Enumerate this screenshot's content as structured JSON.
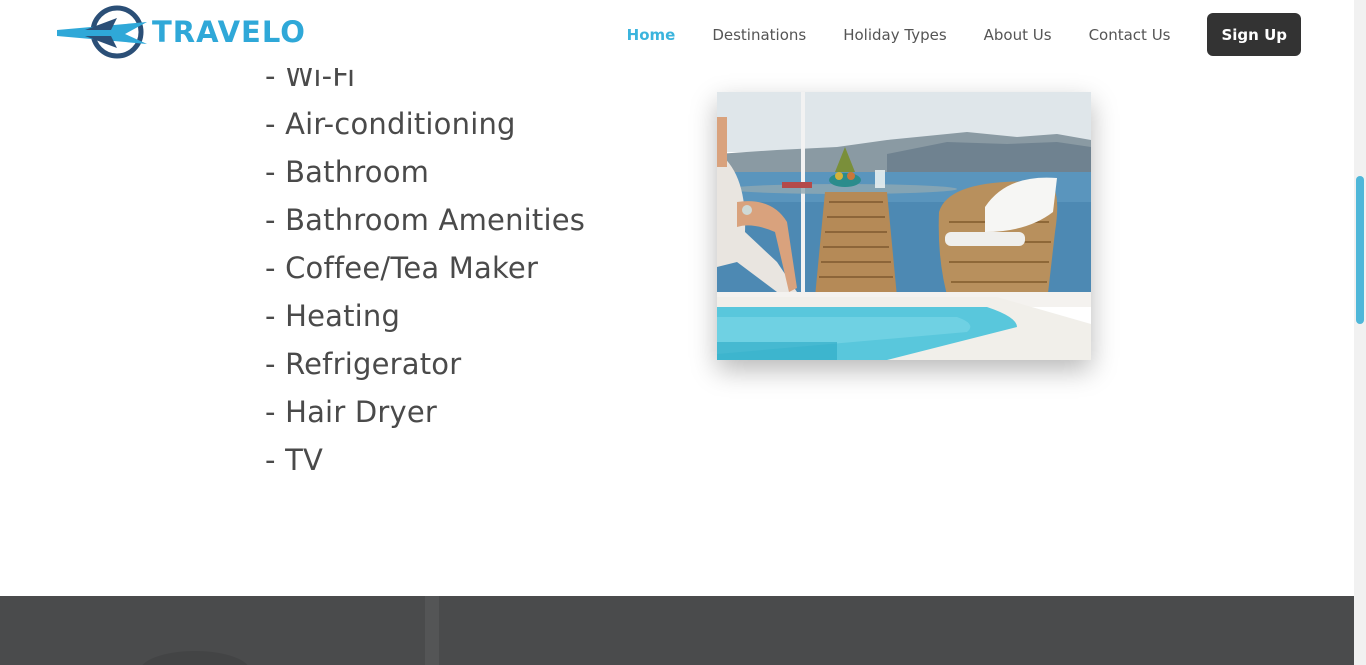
{
  "header": {
    "logo_text": "TRAVELO",
    "brand_color": "#2fa8d8",
    "nav": [
      {
        "label": "Home",
        "active": true
      },
      {
        "label": "Destinations",
        "active": false
      },
      {
        "label": "Holiday Types",
        "active": false
      },
      {
        "label": "About Us",
        "active": false
      },
      {
        "label": "Contact Us",
        "active": false
      }
    ],
    "signup_label": "Sign Up"
  },
  "amenities": [
    "- Wi-Fi",
    "- Air-conditioning",
    "- Bathroom",
    "- Bathroom Amenities",
    "- Coffee/Tea Maker",
    "- Heating",
    "- Refrigerator",
    "- Hair Dryer",
    "- TV"
  ],
  "photo": {
    "subject": "poolside terrace with wicker chairs, sea view"
  },
  "colors": {
    "accent": "#3bb4dd",
    "text": "#4a4a4a",
    "button_bg": "#333333",
    "dark_section": "#4a4b4c",
    "scroll_thumb": "#4fb7d9"
  }
}
